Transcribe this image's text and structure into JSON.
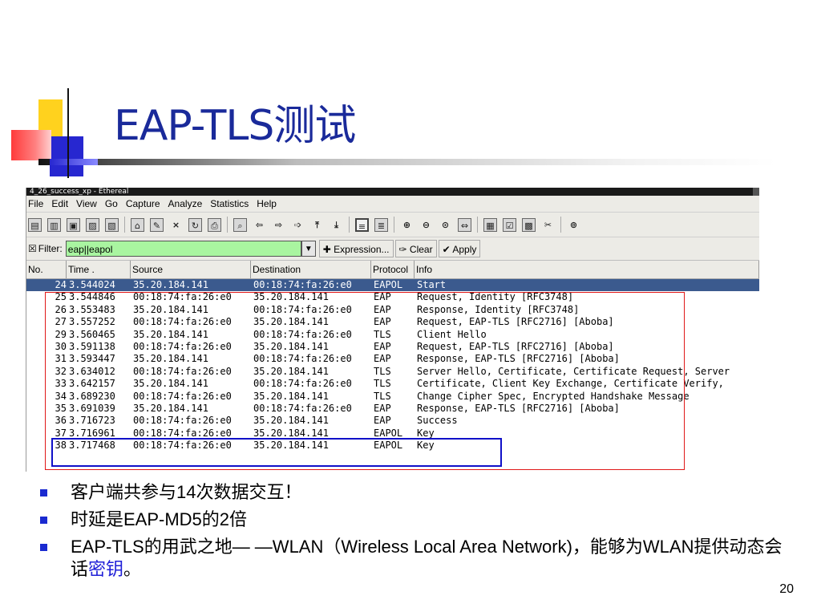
{
  "slide": {
    "title": "EAP-TLS测试",
    "page_number": "20"
  },
  "window": {
    "title": "4_26_success_xp - Ethereal",
    "menu": [
      "File",
      "Edit",
      "View",
      "Go",
      "Capture",
      "Analyze",
      "Statistics",
      "Help"
    ],
    "filter": {
      "label": "Filter:",
      "value": "eap||eapol",
      "expression_btn": "Expression...",
      "clear_btn": "Clear",
      "apply_btn": "Apply"
    },
    "columns": [
      "No.",
      "Time .",
      "Source",
      "Destination",
      "Protocol",
      "Info"
    ],
    "packets": [
      {
        "no": "24",
        "time": "3.544024",
        "src": "35.20.184.141",
        "dst": "00:18:74:fa:26:e0",
        "proto": "EAPOL",
        "info": "Start"
      },
      {
        "no": "25",
        "time": "3.544846",
        "src": "00:18:74:fa:26:e0",
        "dst": "35.20.184.141",
        "proto": "EAP",
        "info": "Request, Identity [RFC3748]"
      },
      {
        "no": "26",
        "time": "3.553483",
        "src": "35.20.184.141",
        "dst": "00:18:74:fa:26:e0",
        "proto": "EAP",
        "info": "Response, Identity [RFC3748]"
      },
      {
        "no": "27",
        "time": "3.557252",
        "src": "00:18:74:fa:26:e0",
        "dst": "35.20.184.141",
        "proto": "EAP",
        "info": "Request, EAP-TLS [RFC2716] [Aboba]"
      },
      {
        "no": "29",
        "time": "3.560465",
        "src": "35.20.184.141",
        "dst": "00:18:74:fa:26:e0",
        "proto": "TLS",
        "info": "Client Hello"
      },
      {
        "no": "30",
        "time": "3.591138",
        "src": "00:18:74:fa:26:e0",
        "dst": "35.20.184.141",
        "proto": "EAP",
        "info": "Request, EAP-TLS [RFC2716] [Aboba]"
      },
      {
        "no": "31",
        "time": "3.593447",
        "src": "35.20.184.141",
        "dst": "00:18:74:fa:26:e0",
        "proto": "EAP",
        "info": "Response, EAP-TLS [RFC2716] [Aboba]"
      },
      {
        "no": "32",
        "time": "3.634012",
        "src": "00:18:74:fa:26:e0",
        "dst": "35.20.184.141",
        "proto": "TLS",
        "info": "Server Hello, Certificate, Certificate Request, Server"
      },
      {
        "no": "33",
        "time": "3.642157",
        "src": "35.20.184.141",
        "dst": "00:18:74:fa:26:e0",
        "proto": "TLS",
        "info": "Certificate, Client Key Exchange, Certificate Verify,"
      },
      {
        "no": "34",
        "time": "3.689230",
        "src": "00:18:74:fa:26:e0",
        "dst": "35.20.184.141",
        "proto": "TLS",
        "info": "Change Cipher Spec, Encrypted Handshake Message"
      },
      {
        "no": "35",
        "time": "3.691039",
        "src": "35.20.184.141",
        "dst": "00:18:74:fa:26:e0",
        "proto": "EAP",
        "info": "Response, EAP-TLS [RFC2716] [Aboba]"
      },
      {
        "no": "36",
        "time": "3.716723",
        "src": "00:18:74:fa:26:e0",
        "dst": "35.20.184.141",
        "proto": "EAP",
        "info": "Success"
      },
      {
        "no": "37",
        "time": "3.716961",
        "src": "00:18:74:fa:26:e0",
        "dst": "35.20.184.141",
        "proto": "EAPOL",
        "info": "Key"
      },
      {
        "no": "38",
        "time": "3.717468",
        "src": "00:18:74:fa:26:e0",
        "dst": "35.20.184.141",
        "proto": "EAPOL",
        "info": "Key"
      }
    ]
  },
  "bullets": {
    "b1": "客户端共参与14次数据交互！",
    "b2": "时延是EAP-MD5的2倍",
    "b3_pre": "EAP-TLS的用武之地— —WLAN（Wireless Local Area Network)，能够为WLAN提供动态会话",
    "b3_link": "密钥",
    "b3_post": "。"
  },
  "colors": {
    "title": "#1a2a9a",
    "highlight_red": "#e01818",
    "highlight_blue": "#1010c8",
    "filter_bg": "#a9f5a0",
    "selected_row": "#3b5a8e"
  }
}
